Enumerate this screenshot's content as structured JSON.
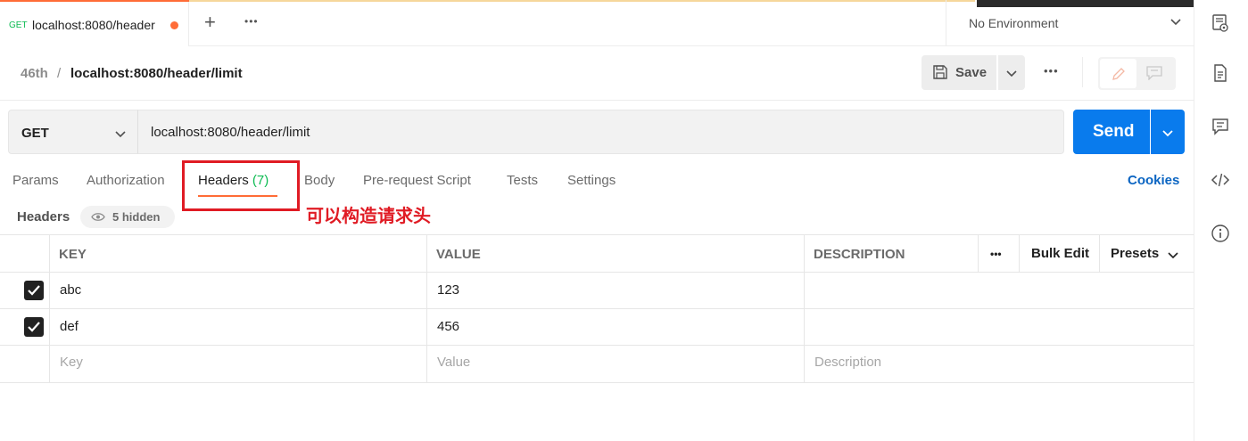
{
  "tab": {
    "method": "GET",
    "name": "localhost:8080/header"
  },
  "tabbar": {
    "plus": "+",
    "more": "•••"
  },
  "environment": {
    "label": "No Environment"
  },
  "breadcrumb": {
    "collection": "46th",
    "separator": "/",
    "request": "localhost:8080/header/limit"
  },
  "toolbar": {
    "save_label": "Save",
    "more": "•••"
  },
  "request": {
    "method": "GET",
    "url": "localhost:8080/header/limit",
    "send_label": "Send"
  },
  "request_tabs": [
    {
      "label": "Params"
    },
    {
      "label": "Authorization"
    },
    {
      "label": "Headers",
      "count": "(7)"
    },
    {
      "label": "Body"
    },
    {
      "label": "Pre-request Script"
    },
    {
      "label": "Tests"
    },
    {
      "label": "Settings"
    }
  ],
  "cookies_label": "Cookies",
  "annotation": "可以构造请求头",
  "headers_section": {
    "title": "Headers",
    "hidden_label": "5 hidden"
  },
  "table": {
    "columns": {
      "key": "KEY",
      "value": "VALUE",
      "description": "DESCRIPTION"
    },
    "more": "•••",
    "bulk_edit": "Bulk Edit",
    "presets": "Presets",
    "rows": [
      {
        "checked": true,
        "key": "abc",
        "value": "123",
        "description": ""
      },
      {
        "checked": true,
        "key": "def",
        "value": "456",
        "description": ""
      }
    ],
    "placeholders": {
      "key": "Key",
      "value": "Value",
      "description": "Description"
    }
  },
  "colors": {
    "accent": "#ff6c37",
    "send": "#097bed",
    "method_get": "#0cbb52",
    "annotation": "#e01b24",
    "link": "#0b65c2"
  }
}
